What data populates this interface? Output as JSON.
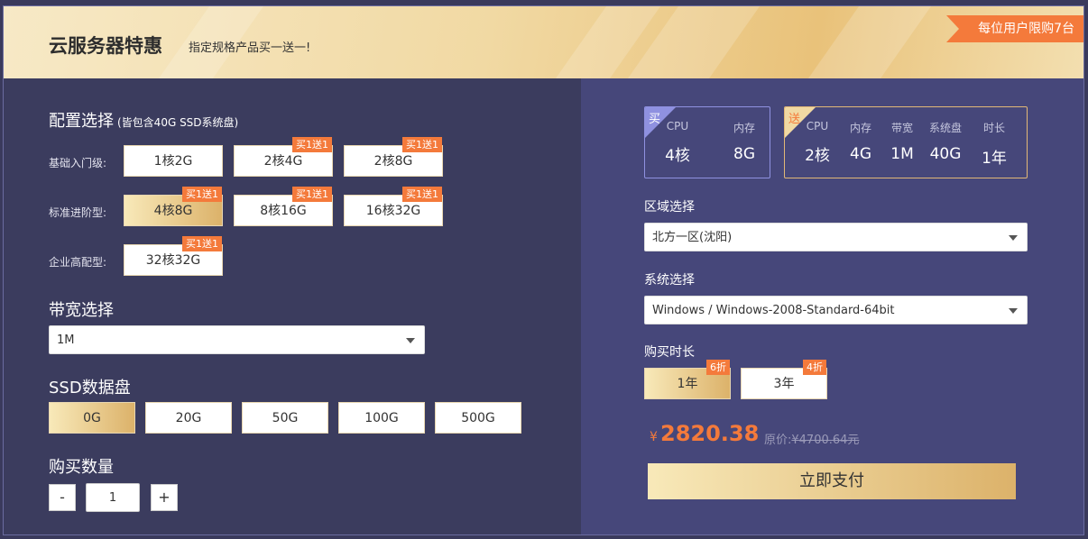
{
  "header": {
    "title": "云服务器特惠",
    "subtitle": "指定规格产品买一送一!",
    "limit_badge": "每位用户限购7台"
  },
  "config": {
    "title": "配置选择",
    "note": "(皆包含40G SSD系统盘)",
    "rows": [
      {
        "label": "基础入门级:",
        "options": [
          {
            "text": "1核2G",
            "tag": "",
            "selected": false
          },
          {
            "text": "2核4G",
            "tag": "买1送1",
            "selected": false
          },
          {
            "text": "2核8G",
            "tag": "买1送1",
            "selected": false
          }
        ]
      },
      {
        "label": "标准进阶型:",
        "options": [
          {
            "text": "4核8G",
            "tag": "买1送1",
            "selected": true
          },
          {
            "text": "8核16G",
            "tag": "买1送1",
            "selected": false
          },
          {
            "text": "16核32G",
            "tag": "买1送1",
            "selected": false
          }
        ]
      },
      {
        "label": "企业高配型:",
        "options": [
          {
            "text": "32核32G",
            "tag": "买1送1",
            "selected": false
          }
        ]
      }
    ]
  },
  "bandwidth": {
    "title": "带宽选择",
    "value": "1M"
  },
  "ssd": {
    "title": "SSD数据盘",
    "options": [
      "0G",
      "20G",
      "50G",
      "100G",
      "500G"
    ],
    "selected": "0G"
  },
  "quantity": {
    "title": "购买数量",
    "minus": "-",
    "value": "1",
    "plus": "+"
  },
  "summary_buy": {
    "corner": "买",
    "cells": [
      {
        "h": "CPU",
        "v": "4核"
      },
      {
        "h": "内存",
        "v": "8G"
      }
    ]
  },
  "summary_gift": {
    "corner": "送",
    "cells": [
      {
        "h": "CPU",
        "v": "2核"
      },
      {
        "h": "内存",
        "v": "4G"
      },
      {
        "h": "带宽",
        "v": "1M"
      },
      {
        "h": "系统盘",
        "v": "40G"
      },
      {
        "h": "时长",
        "v": "1年"
      }
    ]
  },
  "region": {
    "title": "区域选择",
    "value": "北方一区(沈阳)"
  },
  "os": {
    "title": "系统选择",
    "value": "Windows / Windows-2008-Standard-64bit"
  },
  "duration": {
    "title": "购买时长",
    "options": [
      {
        "text": "1年",
        "tag": "6折",
        "selected": true
      },
      {
        "text": "3年",
        "tag": "4折",
        "selected": false
      }
    ]
  },
  "price": {
    "symbol": "¥",
    "amount": "2820.38",
    "original_label": "原价:",
    "original_value": "¥4700.64元"
  },
  "pay_button": "立即支付",
  "colors": {
    "accent": "#f47a3b",
    "gold_start": "#f8e9b9",
    "gold_end": "#dcb26a",
    "left_bg": "#3b3c5e",
    "right_bg": "#46477a"
  }
}
